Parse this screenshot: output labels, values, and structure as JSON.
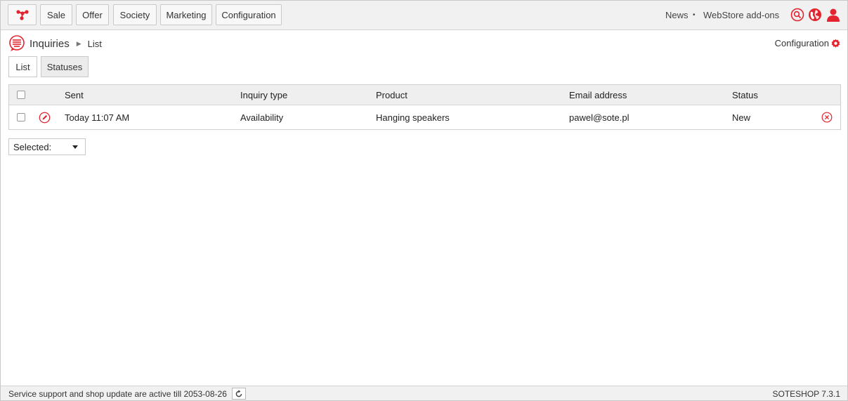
{
  "topbar": {
    "logo_icon": "soteshop-logo-icon",
    "nav": [
      {
        "label": "Sale"
      },
      {
        "label": "Offer"
      },
      {
        "label": "Society"
      },
      {
        "label": "Marketing"
      },
      {
        "label": "Configuration"
      }
    ],
    "links": {
      "news": "News",
      "separator": "•",
      "webstore": "WebStore add-ons"
    },
    "icons": [
      "search-icon",
      "globe-icon",
      "user-icon"
    ]
  },
  "breadcrumb": {
    "section": "Inquiries",
    "separator": "▶",
    "page": "List"
  },
  "config_link": "Configuration",
  "tabs": [
    {
      "label": "List",
      "active": true
    },
    {
      "label": "Statuses",
      "active": false
    }
  ],
  "table": {
    "headers": {
      "sent": "Sent",
      "type": "Inquiry type",
      "product": "Product",
      "email": "Email address",
      "status": "Status"
    },
    "rows": [
      {
        "sent": "Today 11:07 AM",
        "type": "Availability",
        "product": "Hanging speakers",
        "email": "pawel@sote.pl",
        "status": "New"
      }
    ]
  },
  "selected_dropdown": "Selected:",
  "footer": {
    "support": "Service support and shop update are active till 2053-08-26",
    "version": "SOTESHOP 7.3.1"
  },
  "colors": {
    "accent": "#e3232e",
    "topbar": "#f1f1f1",
    "header_row": "#efefef"
  }
}
